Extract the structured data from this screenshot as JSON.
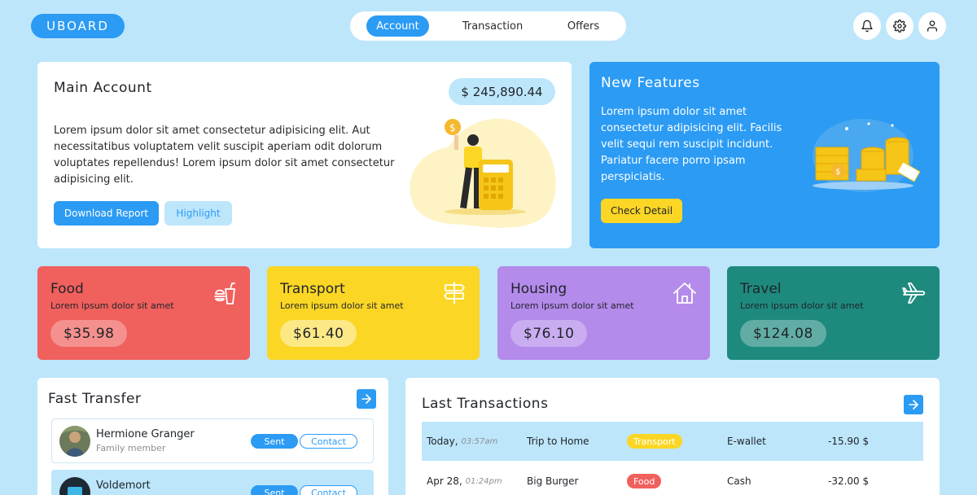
{
  "app": {
    "logo": "UBOARD"
  },
  "nav": {
    "tabs": [
      "Account",
      "Transaction",
      "Offers"
    ]
  },
  "header_icons": [
    "bell-icon",
    "gear-icon",
    "user-icon"
  ],
  "main_account": {
    "title": "Main Account",
    "balance": "$ 245,890.44",
    "description": "Lorem ipsum dolor sit amet consectetur adipisicing elit. Aut necessitatibus voluptatem velit suscipit aperiam odit dolorum voluptates repellendus! Lorem ipsum dolor sit amet consectetur adipisicing elit.",
    "download_label": "Download Report",
    "highlight_label": "Highlight"
  },
  "features": {
    "title": "New Features",
    "description": "Lorem ipsum dolor sit amet consectetur adipisicing elit. Facilis velit sequi rem suscipit incidunt. Pariatur facere porro ipsam perspiciatis.",
    "button_label": "Check Detail"
  },
  "categories": [
    {
      "name": "Food",
      "subtitle": "Lorem ipsum dolor sit amet",
      "amount": "$35.98",
      "icon": "burger-icon",
      "color": "#f0605d"
    },
    {
      "name": "Transport",
      "subtitle": "Lorem ipsum dolor sit amet",
      "amount": "$61.40",
      "icon": "signpost-icon",
      "color": "#fbd624"
    },
    {
      "name": "Housing",
      "subtitle": "Lorem ipsum dolor sit amet",
      "amount": "$76.10",
      "icon": "house-icon",
      "color": "#b48aeb"
    },
    {
      "name": "Travel",
      "subtitle": "Lorem ipsum dolor sit amet",
      "amount": "$124.08",
      "icon": "plane-icon",
      "color": "#1e8a7e"
    }
  ],
  "fast_transfer": {
    "title": "Fast Transfer",
    "people": [
      {
        "name": "Hermione Granger",
        "role": "Family member",
        "sent_label": "Sent",
        "contact_label": "Contact"
      },
      {
        "name": "Voldemort",
        "role": "",
        "sent_label": "Sent",
        "contact_label": "Contact"
      }
    ]
  },
  "last_transactions": {
    "title": "Last Transactions",
    "rows": [
      {
        "date": "Today,",
        "time": "03:57am",
        "description": "Trip to Home",
        "category": "Transport",
        "category_color": "#fbd624",
        "method": "E-wallet",
        "amount": "-15.90 $"
      },
      {
        "date": "Apr 28,",
        "time": "01:24pm",
        "description": "Big Burger",
        "category": "Food",
        "category_color": "#f0605d",
        "method": "Cash",
        "amount": "-32.00 $"
      }
    ]
  }
}
